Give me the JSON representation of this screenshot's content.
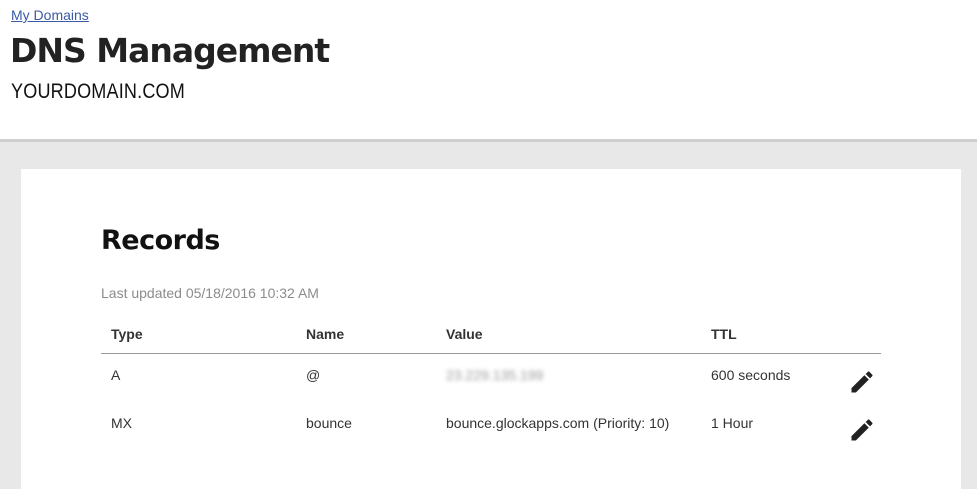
{
  "header": {
    "breadcrumb": "My Domains",
    "title": "DNS Management",
    "domain": "YOURDOMAIN.COM"
  },
  "records": {
    "title": "Records",
    "last_updated": "Last updated 05/18/2016 10:32 AM",
    "columns": {
      "type": "Type",
      "name": "Name",
      "value": "Value",
      "ttl": "TTL"
    },
    "rows": [
      {
        "type": "A",
        "name": "@",
        "value": "23.229.135.199",
        "ttl": "600 seconds"
      },
      {
        "type": "MX",
        "name": "bounce",
        "value": "bounce.glockapps.com (Priority: 10)",
        "ttl": "1 Hour"
      }
    ]
  },
  "icons": {
    "edit": "pencil-icon"
  },
  "colors": {
    "link": "#3b5aa6",
    "background": "#e8e8e8",
    "muted_text": "#8c8c8c"
  }
}
